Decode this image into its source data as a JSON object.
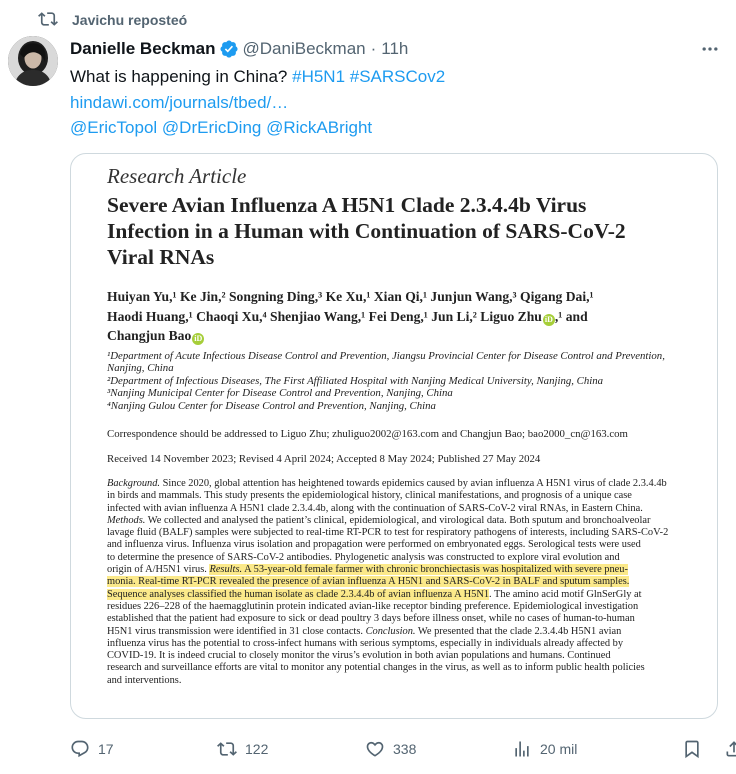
{
  "repost": {
    "label": "Javichu reposteó",
    "icon": "retweet-icon"
  },
  "tweet": {
    "author_name": "Danielle Beckman",
    "handle": "@DaniBeckman",
    "separator": "·",
    "time": "11h",
    "text_prefix": "What is happening in China?",
    "hashtags": [
      "#H5N1",
      "#SARSCov2"
    ],
    "url": "hindawi.com/journals/tbed/…",
    "mentions": [
      "@EricTopol",
      "@DrEricDing",
      "@RickABright"
    ]
  },
  "paper": {
    "type": "Research Article",
    "title_lines": [
      "Severe Avian Influenza A H5N1 Clade 2.3.4.4b Virus",
      "Infection in a Human with Continuation of SARS-CoV-2",
      "Viral RNAs"
    ],
    "author_lines": [
      "Huiyan Yu,¹ Ke Jin,² Songning Ding,³ Ke Xu,¹ Xian Qi,¹ Junjun Wang,³ Qigang Dai,¹",
      "Haodi Huang,¹ Chaoqi Xu,⁴ Shenjiao Wang,¹ Fei Deng,¹ Jun Li,² Liguo Zhu",
      "Changjun Bao"
    ],
    "author_line2_tail": ",¹ and",
    "affiliations": [
      "¹Department of Acute Infectious Disease Control and Prevention, Jiangsu Provincial Center for Disease Control and Prevention,",
      "Nanjing, China",
      "²Department of Infectious Diseases, The First Affiliated Hospital with Nanjing Medical University, Nanjing, China",
      "³Nanjing Municipal Center for Disease Control and Prevention, Nanjing, China",
      "⁴Nanjing Gulou Center for Disease Control and Prevention, Nanjing, China"
    ],
    "correspondence": "Correspondence should be addressed to Liguo Zhu; zhuliguo2002@163.com and Changjun Bao; bao2000_cn@163.com",
    "dates": "Received 14 November 2023; Revised 4 April 2024; Accepted 8 May 2024; Published 27 May 2024",
    "abstract_lines": [
      [
        {
          "t": "Background.",
          "i": true
        },
        {
          "t": " Since 2020, global attention has heightened towards epidemics caused by avian influenza A H5N1 virus of clade 2.3.4.4b"
        }
      ],
      [
        {
          "t": "in birds and mammals. This study presents the epidemiological history, clinical manifestations, and prognosis of a unique case"
        }
      ],
      [
        {
          "t": "infected with avian influenza A H5N1 clade 2.3.4.4b, along with the continuation of SARS-CoV-2 viral RNAs, in Eastern China."
        }
      ],
      [
        {
          "t": "Methods.",
          "i": true
        },
        {
          "t": " We collected and analysed the patient’s clinical, epidemiological, and virological data. Both sputum and bronchoalveolar"
        }
      ],
      [
        {
          "t": "lavage fluid (BALF) samples were subjected to real-time RT-PCR to test for respiratory pathogens of interests, including SARS-CoV-2"
        }
      ],
      [
        {
          "t": "and influenza virus. Influenza virus isolation and propagation were performed on embryonated eggs. Serological tests were used"
        }
      ],
      [
        {
          "t": "to determine the presence of SARS-CoV-2 antibodies. Phylogenetic analysis was constructed to explore viral evolution and"
        }
      ],
      [
        {
          "t": "origin of A/H5N1 virus. "
        },
        {
          "t": "Results.",
          "i": true,
          "h": true
        },
        {
          "t": " A 53-year-old female farmer with chronic bronchiectasis was hospitalized with severe pneu-",
          "h": true
        }
      ],
      [
        {
          "t": "monia. Real-time RT-PCR revealed the presence of avian influenza A H5N1 and SARS-CoV-2 in BALF and sputum samples.",
          "h": true
        }
      ],
      [
        {
          "t": "Sequence analyses classified the human isolate as clade 2.3.4.4b of avian influenza A H5N1",
          "h": true
        },
        {
          "t": ". The amino acid motif GlnSerGly at"
        }
      ],
      [
        {
          "t": "residues 226–228 of the haemagglutinin protein indicated avian-like receptor binding preference. Epidemiological investigation"
        }
      ],
      [
        {
          "t": "established that the patient had exposure to sick or dead poultry 3 days before illness onset, while no cases of human-to-human"
        }
      ],
      [
        {
          "t": "H5N1 virus transmission were identified in 31 close contacts. "
        },
        {
          "t": "Conclusion.",
          "i": true
        },
        {
          "t": " We presented that the clade 2.3.4.4b H5N1 avian"
        }
      ],
      [
        {
          "t": "influenza virus has the potential to cross-infect humans with serious symptoms, especially in individuals already affected by"
        }
      ],
      [
        {
          "t": "COVID-19. It is indeed crucial to closely monitor the virus’s evolution in both avian populations and humans. Continued"
        }
      ],
      [
        {
          "t": "research and surveillance efforts are vital to monitor any potential changes in the virus, as well as to inform public health policies"
        }
      ],
      [
        {
          "t": "and interventions."
        }
      ]
    ]
  },
  "actions": {
    "replies": "17",
    "reposts": "122",
    "likes": "338",
    "views": "20 mil"
  },
  "colors": {
    "link": "#1d9bf0",
    "muted": "#536471",
    "highlight": "#fbe98a",
    "verified": "#1d9bf0"
  }
}
